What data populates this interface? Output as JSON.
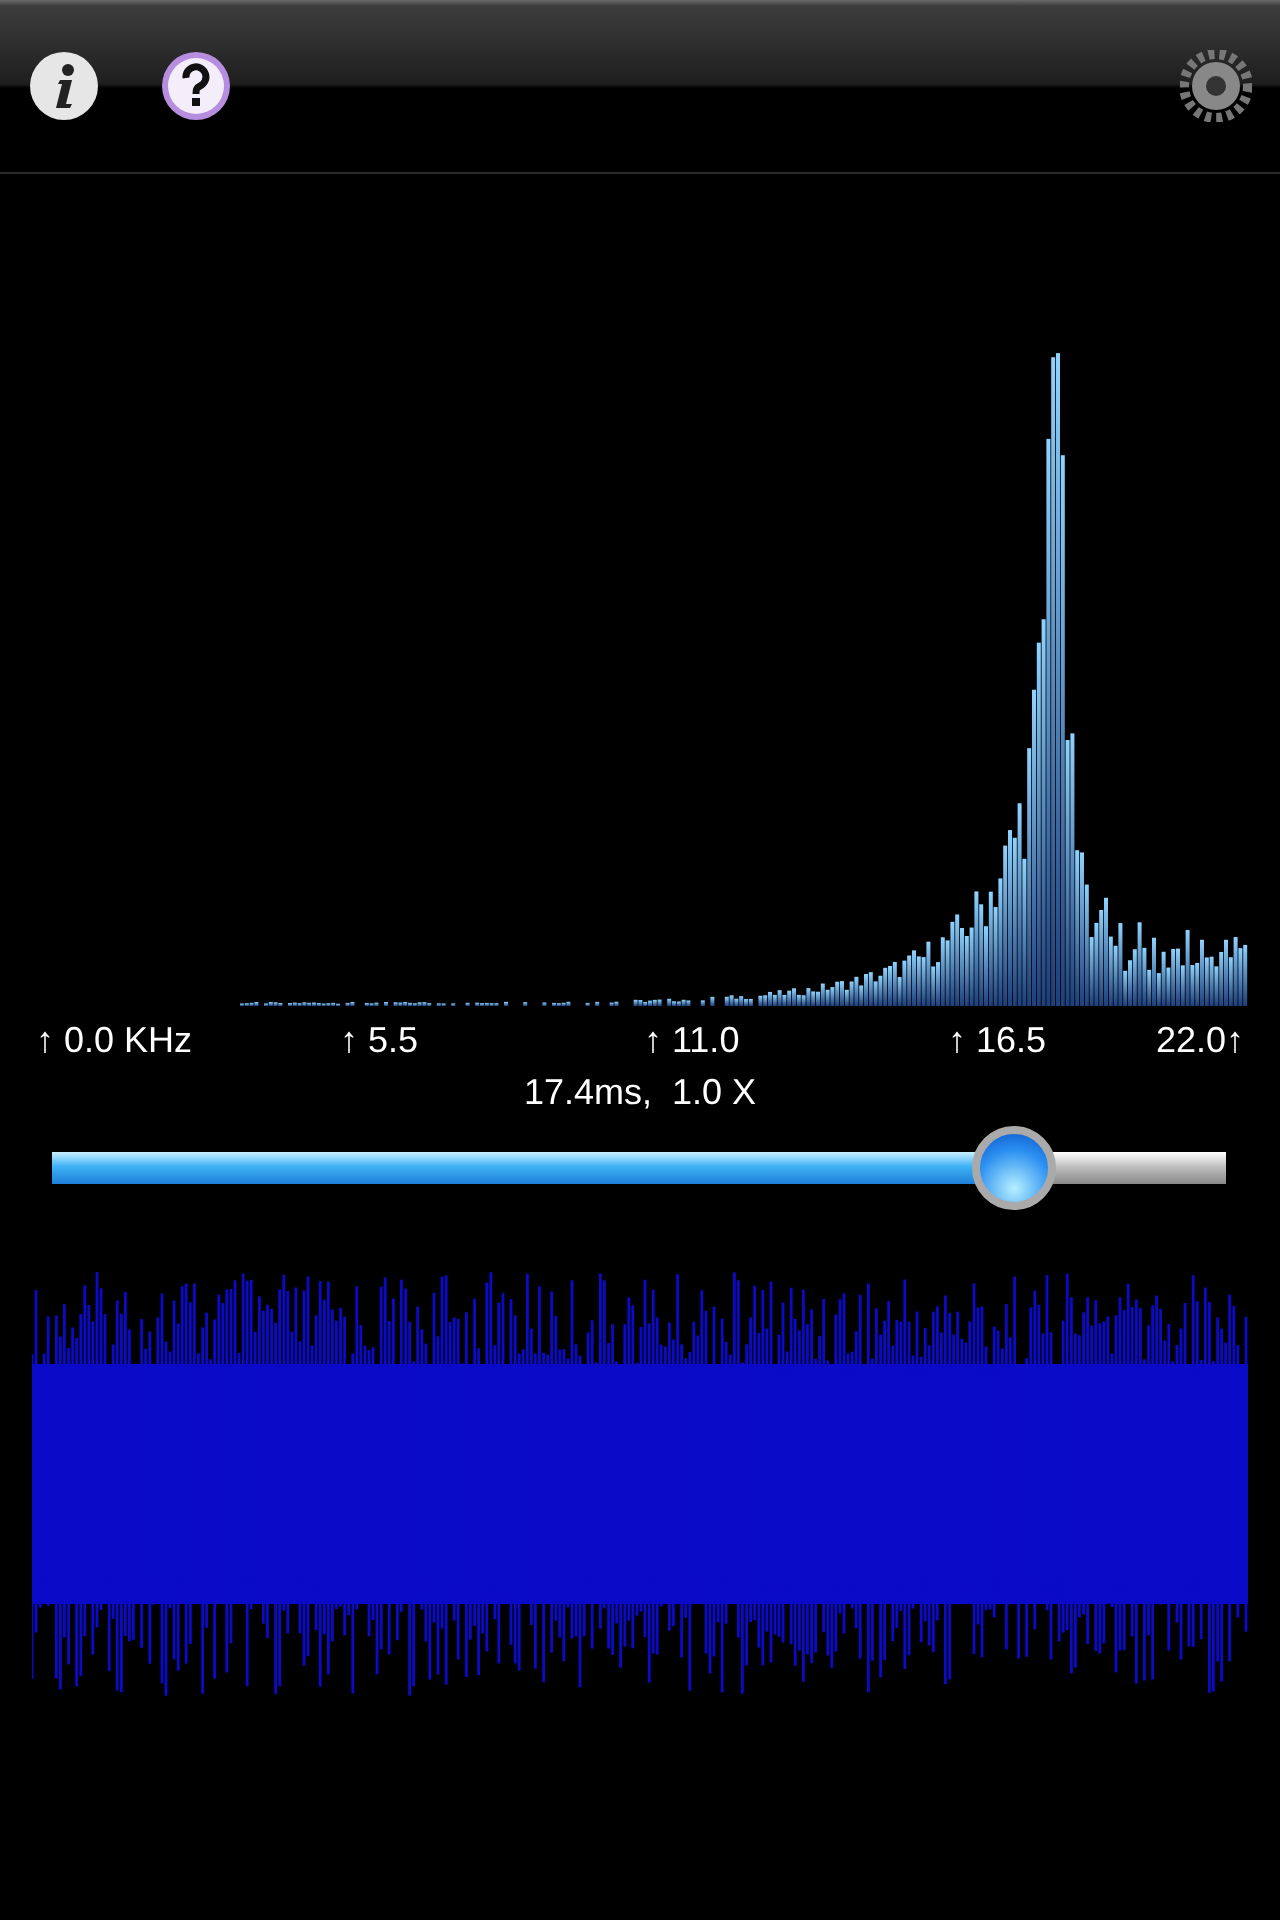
{
  "frequency_labels": [
    "↑ 0.0 KHz",
    "↑ 5.5",
    "↑ 11.0",
    "↑ 16.5",
    "22.0↑"
  ],
  "readout": "17.4ms,  1.0 X",
  "slider": {
    "level": 0.82
  }
}
